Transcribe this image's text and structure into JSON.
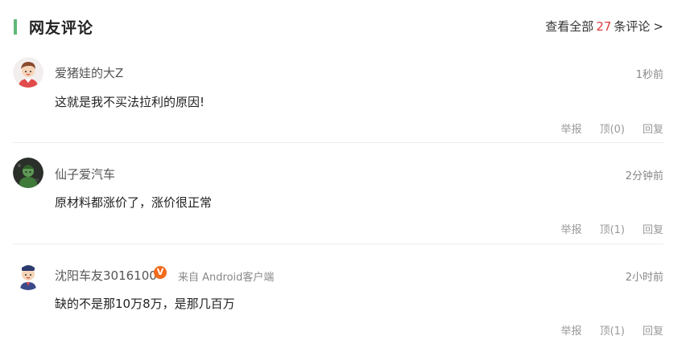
{
  "header": {
    "title": "网友评论",
    "link_prefix": "查看全部",
    "count": "27",
    "link_suffix": "条评论",
    "chevron": ">",
    "accent_color": "#5fb878",
    "count_color": "#e0393e"
  },
  "comments": [
    {
      "username": "爱猪娃的大Z",
      "time": "1秒前",
      "content": "这就是我不买法拉利的原因!",
      "report_label": "举报",
      "like_label": "顶(0)",
      "reply_label": "回复",
      "avatar_icon": "cartoon-boy-avatar-icon"
    },
    {
      "username": "仙子爱汽车",
      "time": "2分钟前",
      "content": "原材料都涨价了，涨价很正常",
      "report_label": "举报",
      "like_label": "顶(1)",
      "reply_label": "回复",
      "avatar_icon": "green-figure-avatar-icon"
    },
    {
      "username": "沈阳车友3016100",
      "vip_badge": "V",
      "source": "来自 Android客户端",
      "time": "2小时前",
      "content": "缺的不是那10万8万，是那几百万",
      "report_label": "举报",
      "like_label": "顶(1)",
      "reply_label": "回复",
      "avatar_icon": "cartoon-man-avatar-icon"
    }
  ]
}
